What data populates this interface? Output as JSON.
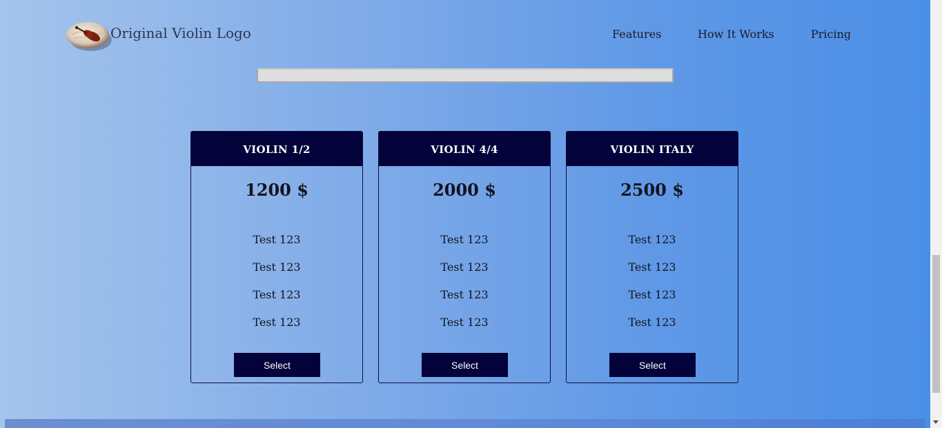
{
  "header": {
    "logo_icon": "violin-logo-icon",
    "logo_text": "Original Violin Logo",
    "nav": [
      {
        "label": "Features"
      },
      {
        "label": "How It Works"
      },
      {
        "label": "Pricing"
      }
    ]
  },
  "search": {
    "value": ""
  },
  "pricing": {
    "cards": [
      {
        "title": "VIOLIN 1/2",
        "price": "1200 $",
        "features": [
          "Test 123",
          "Test 123",
          "Test 123",
          "Test 123"
        ],
        "button_label": "Select"
      },
      {
        "title": "VIOLIN 4/4",
        "price": "2000 $",
        "features": [
          "Test 123",
          "Test 123",
          "Test 123",
          "Test 123"
        ],
        "button_label": "Select"
      },
      {
        "title": "VIOLIN ITALY",
        "price": "2500 $",
        "features": [
          "Test 123",
          "Test 123",
          "Test 123",
          "Test 123"
        ],
        "button_label": "Select"
      }
    ]
  },
  "colors": {
    "card_header": "#03023a",
    "button": "#03023a",
    "background_start": "#a5c4ec",
    "background_end": "#4a8ee6"
  }
}
